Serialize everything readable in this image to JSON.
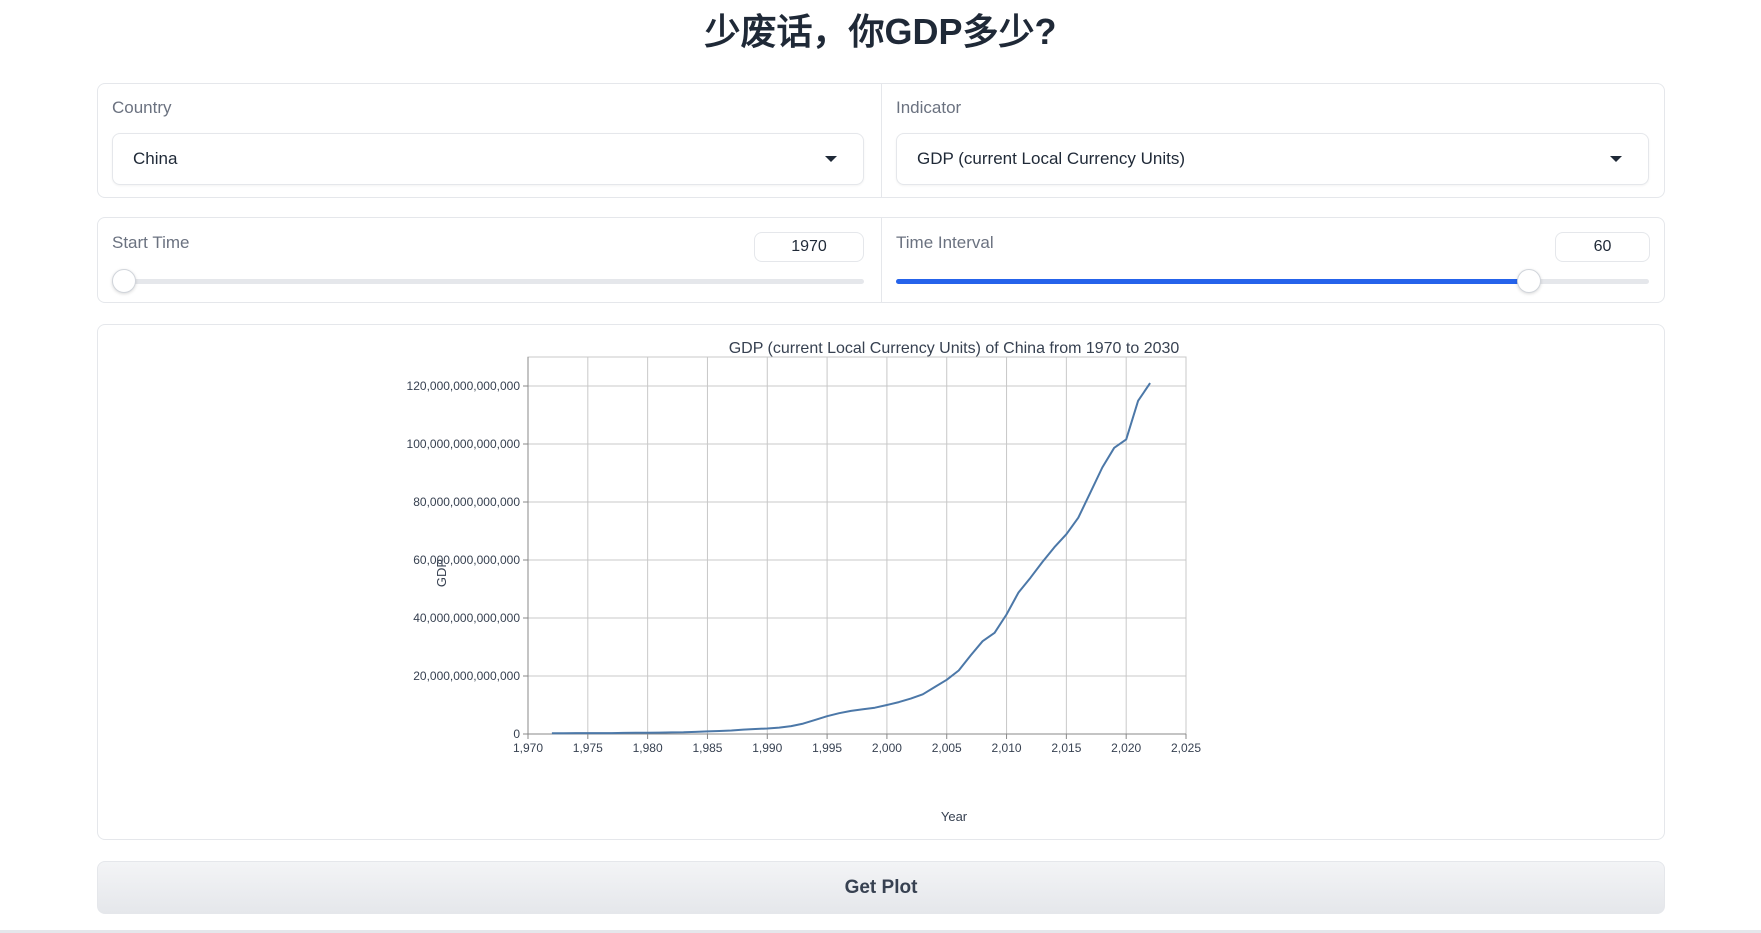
{
  "header": {
    "title": "少废话，你GDP多少?"
  },
  "controls": {
    "country": {
      "label": "Country",
      "value": "China"
    },
    "indicator": {
      "label": "Indicator",
      "value": "GDP (current Local Currency Units)"
    },
    "start_time": {
      "label": "Start Time",
      "value": "1970",
      "min": 1970,
      "max": 2023
    },
    "time_interval": {
      "label": "Time Interval",
      "value": "60",
      "fraction": 0.84
    }
  },
  "button": {
    "label": "Get Plot"
  },
  "colors": {
    "accent": "#2563eb",
    "line": "#4c78a8"
  },
  "chart_data": {
    "type": "line",
    "title": "GDP (current Local Currency Units) of China from 1970 to 2030",
    "xlabel": "Year",
    "ylabel": "GDP",
    "xlim": [
      1970,
      2025
    ],
    "ylim": [
      0,
      130000000000000
    ],
    "xticks": [
      1970,
      1975,
      1980,
      1985,
      1990,
      1995,
      2000,
      2005,
      2010,
      2015,
      2020,
      2025
    ],
    "xtick_labels": [
      "1,970",
      "1,975",
      "1,980",
      "1,985",
      "1,990",
      "1,995",
      "2,000",
      "2,005",
      "2,010",
      "2,015",
      "2,020",
      "2,025"
    ],
    "yticks": [
      0,
      20000000000000,
      40000000000000,
      60000000000000,
      80000000000000,
      100000000000000,
      120000000000000
    ],
    "ytick_labels": [
      "0",
      "20,000,000,000,000",
      "40,000,000,000,000",
      "60,000,000,000,000",
      "80,000,000,000,000",
      "100,000,000,000,000",
      "120,000,000,000,000"
    ],
    "grid": true,
    "series": [
      {
        "x": [
          1972,
          1973,
          1974,
          1975,
          1976,
          1977,
          1978,
          1979,
          1980,
          1981,
          1982,
          1983,
          1984,
          1985,
          1986,
          1987,
          1988,
          1989,
          1990,
          1991,
          1992,
          1993,
          1994,
          1995,
          1996,
          1997,
          1998,
          1999,
          2000,
          2001,
          2002,
          2003,
          2004,
          2005,
          2006,
          2007,
          2008,
          2009,
          2010,
          2011,
          2012,
          2013,
          2014,
          2015,
          2016,
          2017,
          2018,
          2019,
          2020,
          2021,
          2022
        ],
        "y": [
          280000000000.0,
          290000000000.0,
          300000000000.0,
          300000000000.0,
          310000000000.0,
          320000000000.0,
          370000000000.0,
          410000000000.0,
          460000000000.0,
          490000000000.0,
          540000000000.0,
          600000000000.0,
          730000000000.0,
          910000000000.0,
          1040000000000.0,
          1220000000000.0,
          1520000000000.0,
          1720000000000.0,
          1890000000000.0,
          2200000000000.0,
          2720000000000.0,
          3570000000000.0,
          4860000000000.0,
          6130000000000.0,
          7180000000000.0,
          7970000000000.0,
          8520000000000.0,
          9060000000000.0,
          10000000000000.0,
          11000000000000.0,
          12200000000000.0,
          13700000000000.0,
          16200000000000.0,
          18700000000000.0,
          21900000000000.0,
          27100000000000.0,
          32000000000000.0,
          34900000000000.0,
          41200000000000.0,
          48800000000000.0,
          53900000000000.0,
          59300000000000.0,
          64400000000000.0,
          68900000000000.0,
          74600000000000.0,
          83200000000000.0,
          91900000000000.0,
          98700000000000.0,
          101600000000000.0,
          114900000000000.0,
          121000000000000.0
        ]
      }
    ]
  }
}
